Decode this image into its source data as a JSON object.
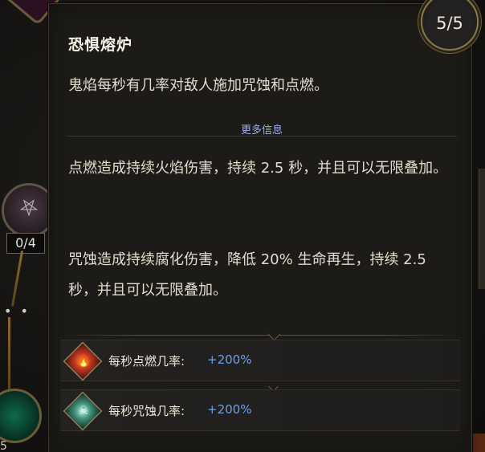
{
  "background": {
    "left_node_counter": "0/4",
    "left_node_sigil_icon": "twisted-sigil-icon",
    "bottom_node_label": "5"
  },
  "tooltip": {
    "title": "恐惧熔炉",
    "rank": "5/5",
    "description": "鬼焰每秒有几率对敌人施加咒蚀和点燃。",
    "more_info_label": "更多信息",
    "details": [
      "点燃造成持续火焰伤害，持续 2.5 秒，并且可以无限叠加。",
      "咒蚀造成持续腐化伤害，降低 20% 生命再生，持续 2.5 秒，并且可以无限叠加。"
    ],
    "stats": [
      {
        "icon": "fire-icon",
        "label": "每秒点燃几率:",
        "value": "+200%"
      },
      {
        "icon": "curse-skull-icon",
        "label": "每秒咒蚀几率:",
        "value": "+200%"
      }
    ]
  },
  "colors": {
    "stat_value": "#6fa0ea",
    "more_info": "#9fb2e8",
    "text": "#e3dccd",
    "panel": "#1c1b18",
    "gold_border": "#8a7748"
  }
}
